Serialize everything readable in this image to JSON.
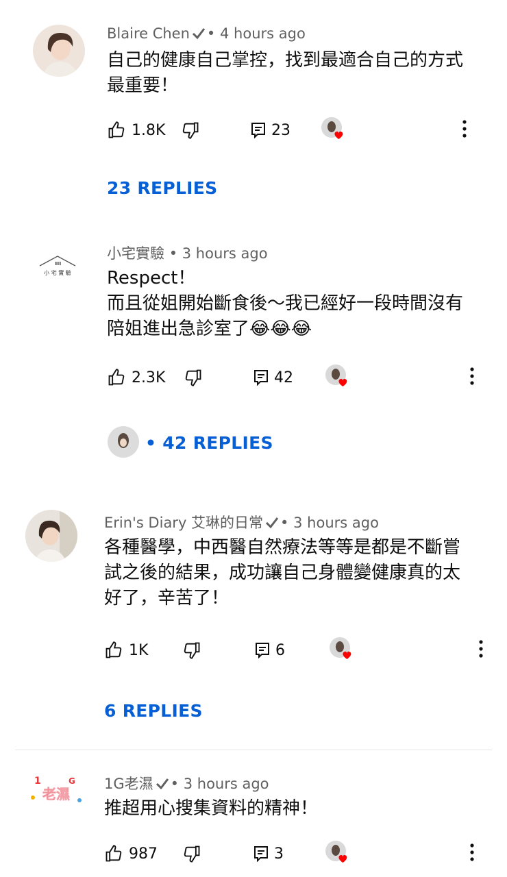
{
  "comments": [
    {
      "author": "Blaire Chen",
      "verified": true,
      "time": "4 hours ago",
      "text": "自己的健康自己掌控，找到最適合自己的方式最重要！",
      "likes": "1.8K",
      "reply_count": "23",
      "replies_label": "23 REPLIES"
    },
    {
      "author": "小宅實驗",
      "verified": false,
      "time": "3 hours ago",
      "text_line1": "Respect！",
      "text_line2": "而且從姐開始斷食後～我已經好一段時間沒有陪姐進出急診室了😂😂😂",
      "avatar_text": "小 宅 實 驗",
      "likes": "2.3K",
      "reply_count": "42",
      "replies_label": "42 REPLIES"
    },
    {
      "author": "Erin's Diary 艾琳的日常",
      "verified": true,
      "time": "3 hours ago",
      "text": "各種醫學，中西醫自然療法等等是都是不斷嘗試之後的結果，成功讓自己身體變健康真的太好了，辛苦了！",
      "likes": "1K",
      "reply_count": "6",
      "replies_label": "6 REPLIES"
    },
    {
      "author": "1G老濕",
      "verified": true,
      "time": "3 hours ago",
      "text": "推超用心搜集資料的精神！",
      "avatar_text": "老濕",
      "likes": "987",
      "reply_count": "3"
    }
  ],
  "separator": "•",
  "colors": {
    "link": "#065fd4",
    "meta": "#606060",
    "heart": "#ff0000"
  },
  "icons": [
    "like-icon",
    "dislike-icon",
    "reply-icon",
    "creator-heart-icon",
    "more-vert-icon",
    "verified-check-icon"
  ]
}
